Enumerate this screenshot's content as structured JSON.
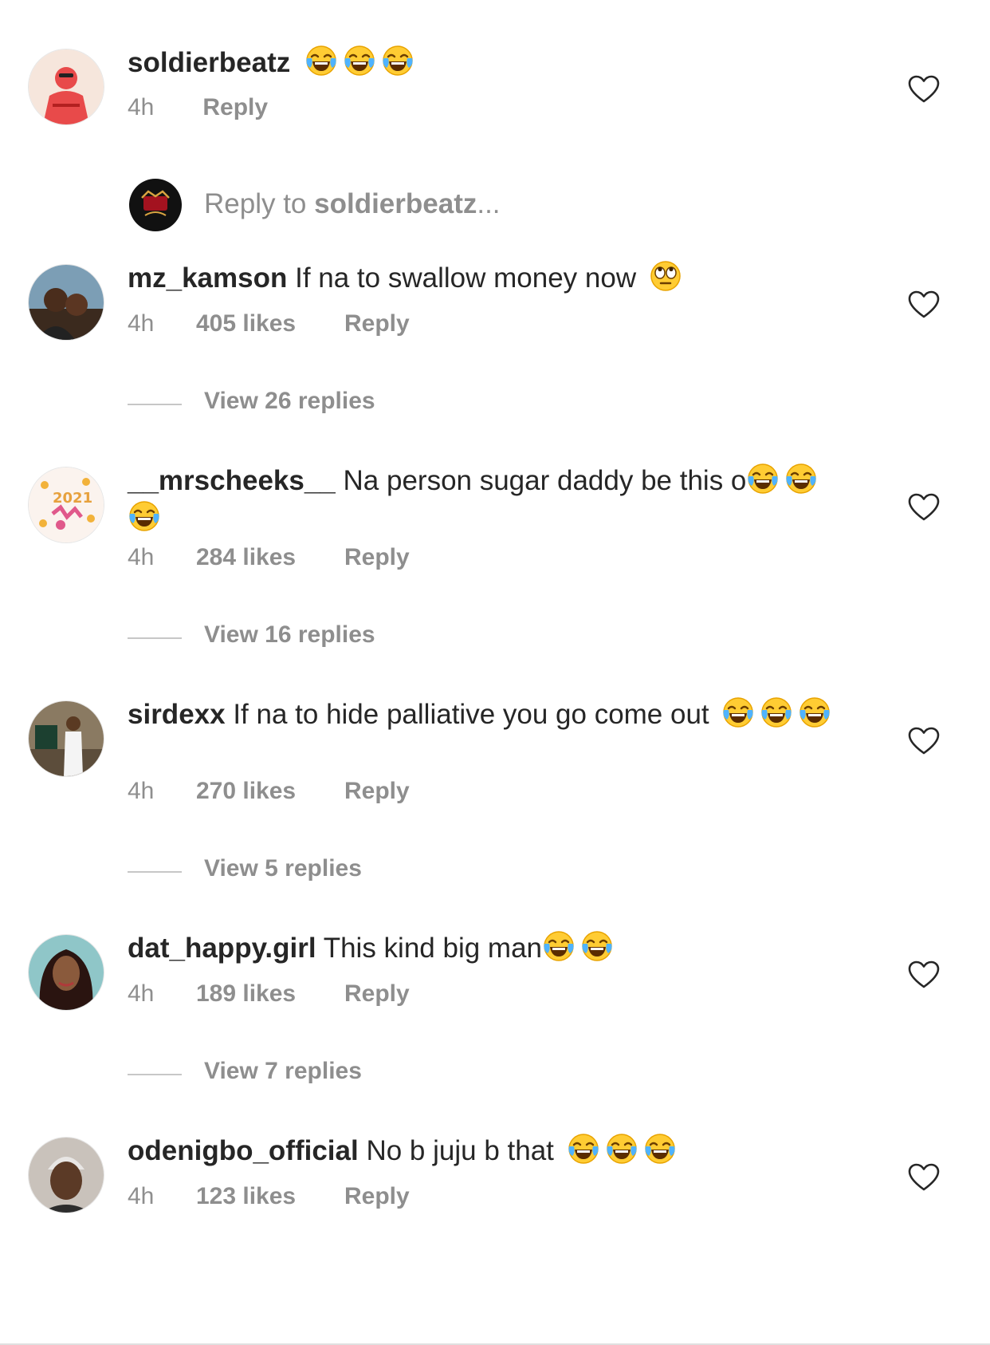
{
  "comments": [
    {
      "username": "soldierbeatz",
      "text": "",
      "emojis": [
        "tears-of-joy",
        "tears-of-joy",
        "tears-of-joy"
      ],
      "time": "4h",
      "likes": "",
      "reply_label": "Reply"
    },
    {
      "username": "mz_kamson",
      "text": "If na to swallow money now",
      "emojis": [
        "rolling-eyes"
      ],
      "time": "4h",
      "likes": "405 likes",
      "reply_label": "Reply",
      "view_replies": "View 26 replies"
    },
    {
      "username": "__mrscheeks__",
      "text": "Na person sugar daddy be this o",
      "emojis": [
        "tears-of-joy",
        "tears-of-joy",
        "tears-of-joy"
      ],
      "time": "4h",
      "likes": "284 likes",
      "reply_label": "Reply",
      "view_replies": "View 16 replies"
    },
    {
      "username": "sirdexx",
      "text": "If na to hide palliative you go come out",
      "emojis": [
        "tears-of-joy",
        "tears-of-joy",
        "tears-of-joy"
      ],
      "time": "4h",
      "likes": "270 likes",
      "reply_label": "Reply",
      "view_replies": "View 5 replies"
    },
    {
      "username": "dat_happy.girl",
      "text": "This kind big man",
      "emojis": [
        "tears-of-joy",
        "tears-of-joy"
      ],
      "time": "4h",
      "likes": "189 likes",
      "reply_label": "Reply",
      "view_replies": "View 7 replies"
    },
    {
      "username": "odenigbo_official",
      "text": "No b juju b that",
      "emojis": [
        "tears-of-joy",
        "tears-of-joy",
        "tears-of-joy"
      ],
      "time": "4h",
      "likes": "123 likes",
      "reply_label": "Reply"
    }
  ],
  "reply_composer": {
    "prefix": "Reply to ",
    "target": "soldierbeatz",
    "suffix": "..."
  },
  "colors": {
    "text": "#262626",
    "secondary": "#8e8e8e",
    "divider": "#c7c7c7"
  }
}
